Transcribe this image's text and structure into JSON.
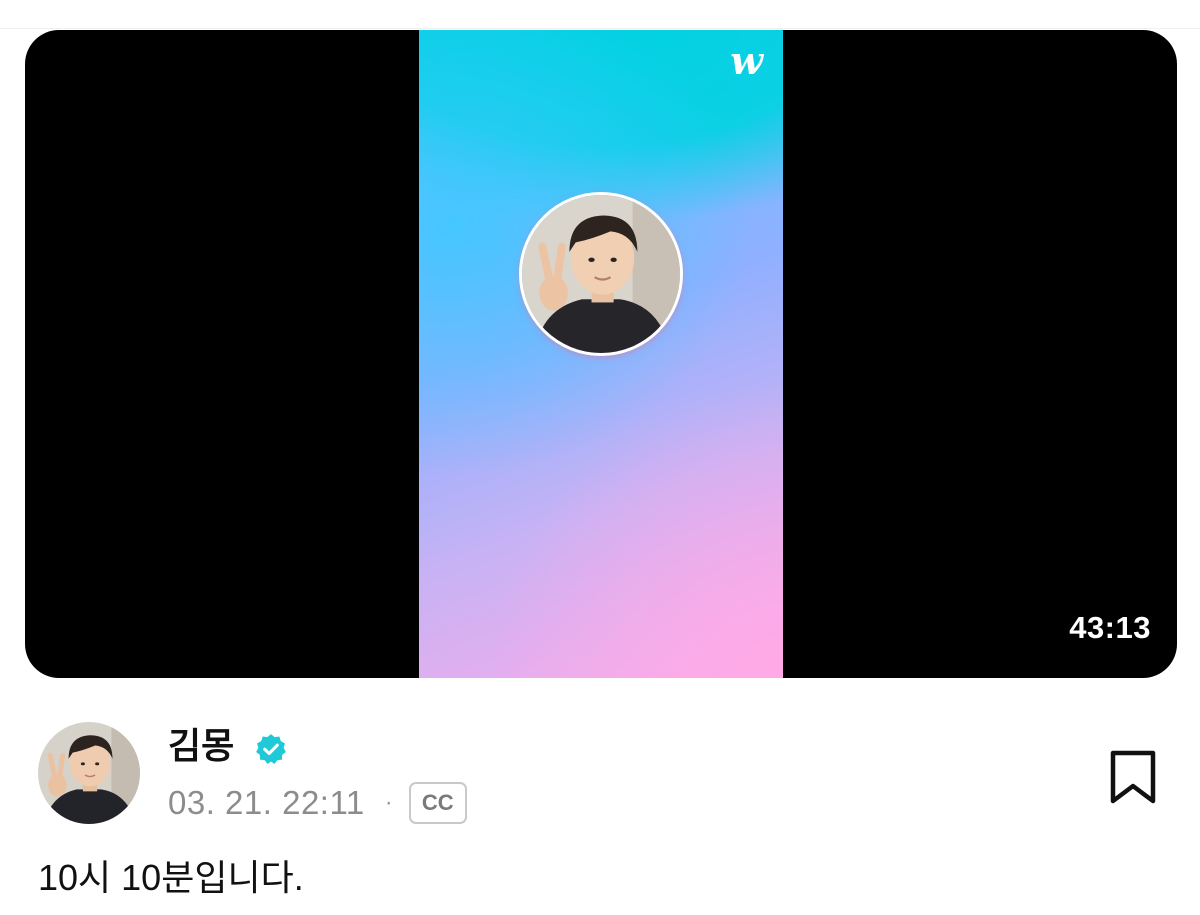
{
  "video": {
    "duration": "43:13",
    "logo_text": "w",
    "logo_icon": "weverse-logo-icon",
    "thumbnail_gradient": [
      "#00d3e0",
      "#58c6ff",
      "#a9b1fb",
      "#f9acea"
    ]
  },
  "post": {
    "author": "김몽",
    "verified": true,
    "verified_color": "#1ec9d8",
    "timestamp": "03. 21. 22:11",
    "separator": "·",
    "cc_label": "CC",
    "text": "10시 10분입니다."
  },
  "actions": {
    "bookmark_icon": "bookmark-icon"
  }
}
